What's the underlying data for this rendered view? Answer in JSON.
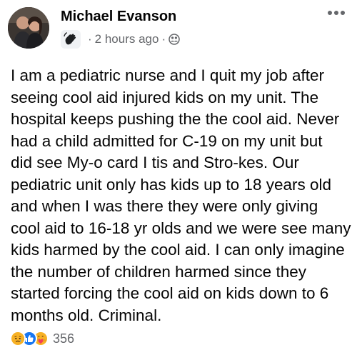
{
  "post": {
    "author": "Michael Evanson",
    "time": "2 hours ago",
    "separator": "·",
    "body_lines": [
      "I am a pediatric nurse and I quit my job after",
      "seeing cool aid injured kids on my unit. The",
      "hospital keeps pushing the the cool aid. Never",
      "had a child admitted for C-19 on my unit but",
      "did see My-o card I tis and Stro-kes. Our",
      "pediatric unit only has kids up to 18 years old",
      "and when I was there they were only giving",
      "cool aid to 16-18 yr olds and we were see many",
      "kids harmed by the cool aid. I can only imagine",
      "the number of children harmed since they",
      "started forcing the cool aid on kids down to 6",
      "months old.  Criminal."
    ],
    "reaction_count": "356"
  },
  "icons": {
    "badge": "waving-hand-icon",
    "audience": "friends-audience-icon",
    "more": "more-options-icon",
    "reactions": [
      "sad-reaction-icon",
      "like-reaction-icon",
      "care-reaction-icon"
    ]
  },
  "colors": {
    "like_blue": "#1877f2",
    "reaction_yellow": "#f7b125",
    "secondary_text": "#65676b"
  }
}
